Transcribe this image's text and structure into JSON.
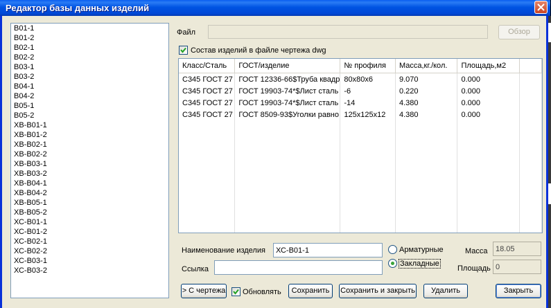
{
  "window": {
    "title": "Редактор базы данных изделий"
  },
  "items_list": [
    "В01-1",
    "В01-2",
    "В02-1",
    "В02-2",
    "В03-1",
    "В03-2",
    "В04-1",
    "В04-2",
    "В05-1",
    "В05-2",
    "ХВ-В01-1",
    "ХВ-В01-2",
    "ХВ-В02-1",
    "ХВ-В02-2",
    "ХВ-В03-1",
    "ХВ-В03-2",
    "ХВ-В04-1",
    "ХВ-В04-2",
    "ХВ-В05-1",
    "ХВ-В05-2",
    "ХС-В01-1",
    "ХС-В01-2",
    "ХС-В02-1",
    "ХС-В02-2",
    "ХС-В03-1",
    "ХС-В03-2"
  ],
  "file": {
    "label": "Файл",
    "value": "",
    "browse_label": "Обзор"
  },
  "composition_checkbox": {
    "label": "Состав изделий в файле чертежа dwg",
    "checked": true
  },
  "table": {
    "columns": [
      "Класс/Сталь",
      "ГОСТ/изделие",
      "№ профиля",
      "Масса,кг./кол.",
      "Площадь,м2"
    ],
    "rows": [
      [
        "С345 ГОСТ 27",
        "ГОСТ 12336-66$Труба квадр",
        "80х80х6",
        "9.070",
        "0.000"
      ],
      [
        "С345 ГОСТ 27",
        "ГОСТ 19903-74*$Лист сталь",
        "-6",
        "0.220",
        "0.000"
      ],
      [
        "С345 ГОСТ 27",
        "ГОСТ 19903-74*$Лист сталь",
        "-14",
        "4.380",
        "0.000"
      ],
      [
        "С345 ГОСТ 27",
        "ГОСТ 8509-93$Уголки равно",
        "125х125х12",
        "4.380",
        "0.000"
      ]
    ]
  },
  "form": {
    "name_label": "Наименование изделия",
    "name_value": "ХС-В01-1",
    "link_label": "Ссылка",
    "link_value": "",
    "radio_reinforcing": "Арматурные",
    "radio_embedded": "Закладные",
    "selected_type": "Закладные",
    "mass_label": "Масса",
    "mass_value": "18.05",
    "area_label": "Площадь",
    "area_value": "0"
  },
  "buttons": {
    "from_drawing": "> С чертежа",
    "refresh_label": "Обновлять",
    "refresh_checked": true,
    "save": "Сохранить",
    "save_close": "Сохранить и закрыть",
    "delete": "Удалить",
    "close": "Закрыть"
  }
}
